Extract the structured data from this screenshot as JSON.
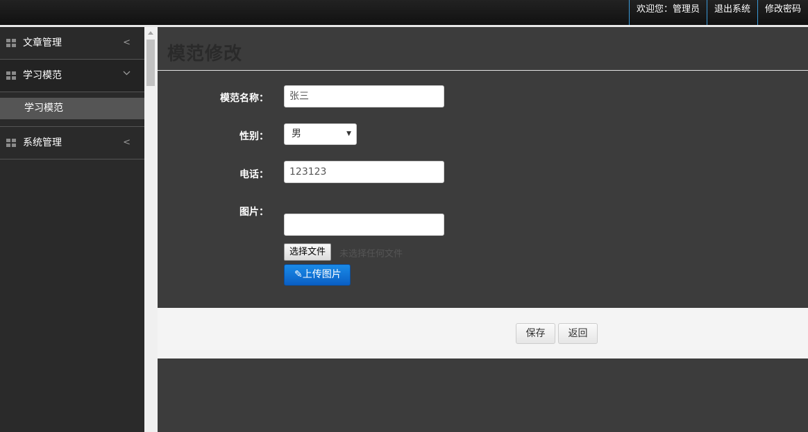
{
  "header": {
    "welcome": "欢迎您：管理员",
    "logout": "退出系统",
    "change_password": "修改密码"
  },
  "sidebar": {
    "items": [
      {
        "label": "文章管理",
        "chevron": "<"
      },
      {
        "label": "学习模范",
        "chevron": "⌄",
        "children": [
          {
            "label": "学习模范"
          }
        ]
      },
      {
        "label": "系统管理",
        "chevron": "<"
      }
    ]
  },
  "main": {
    "title": "模范修改",
    "form": {
      "name_label": "模范名称：",
      "name_value": "张三",
      "gender_label": "性别：",
      "gender_value": "男",
      "phone_label": "电话：",
      "phone_value": "123123",
      "image_label": "图片：",
      "image_value": "",
      "file_button": "选择文件",
      "file_status": "未选择任何文件",
      "upload_button": "上传图片"
    },
    "actions": {
      "save": "保存",
      "back": "返回"
    }
  }
}
